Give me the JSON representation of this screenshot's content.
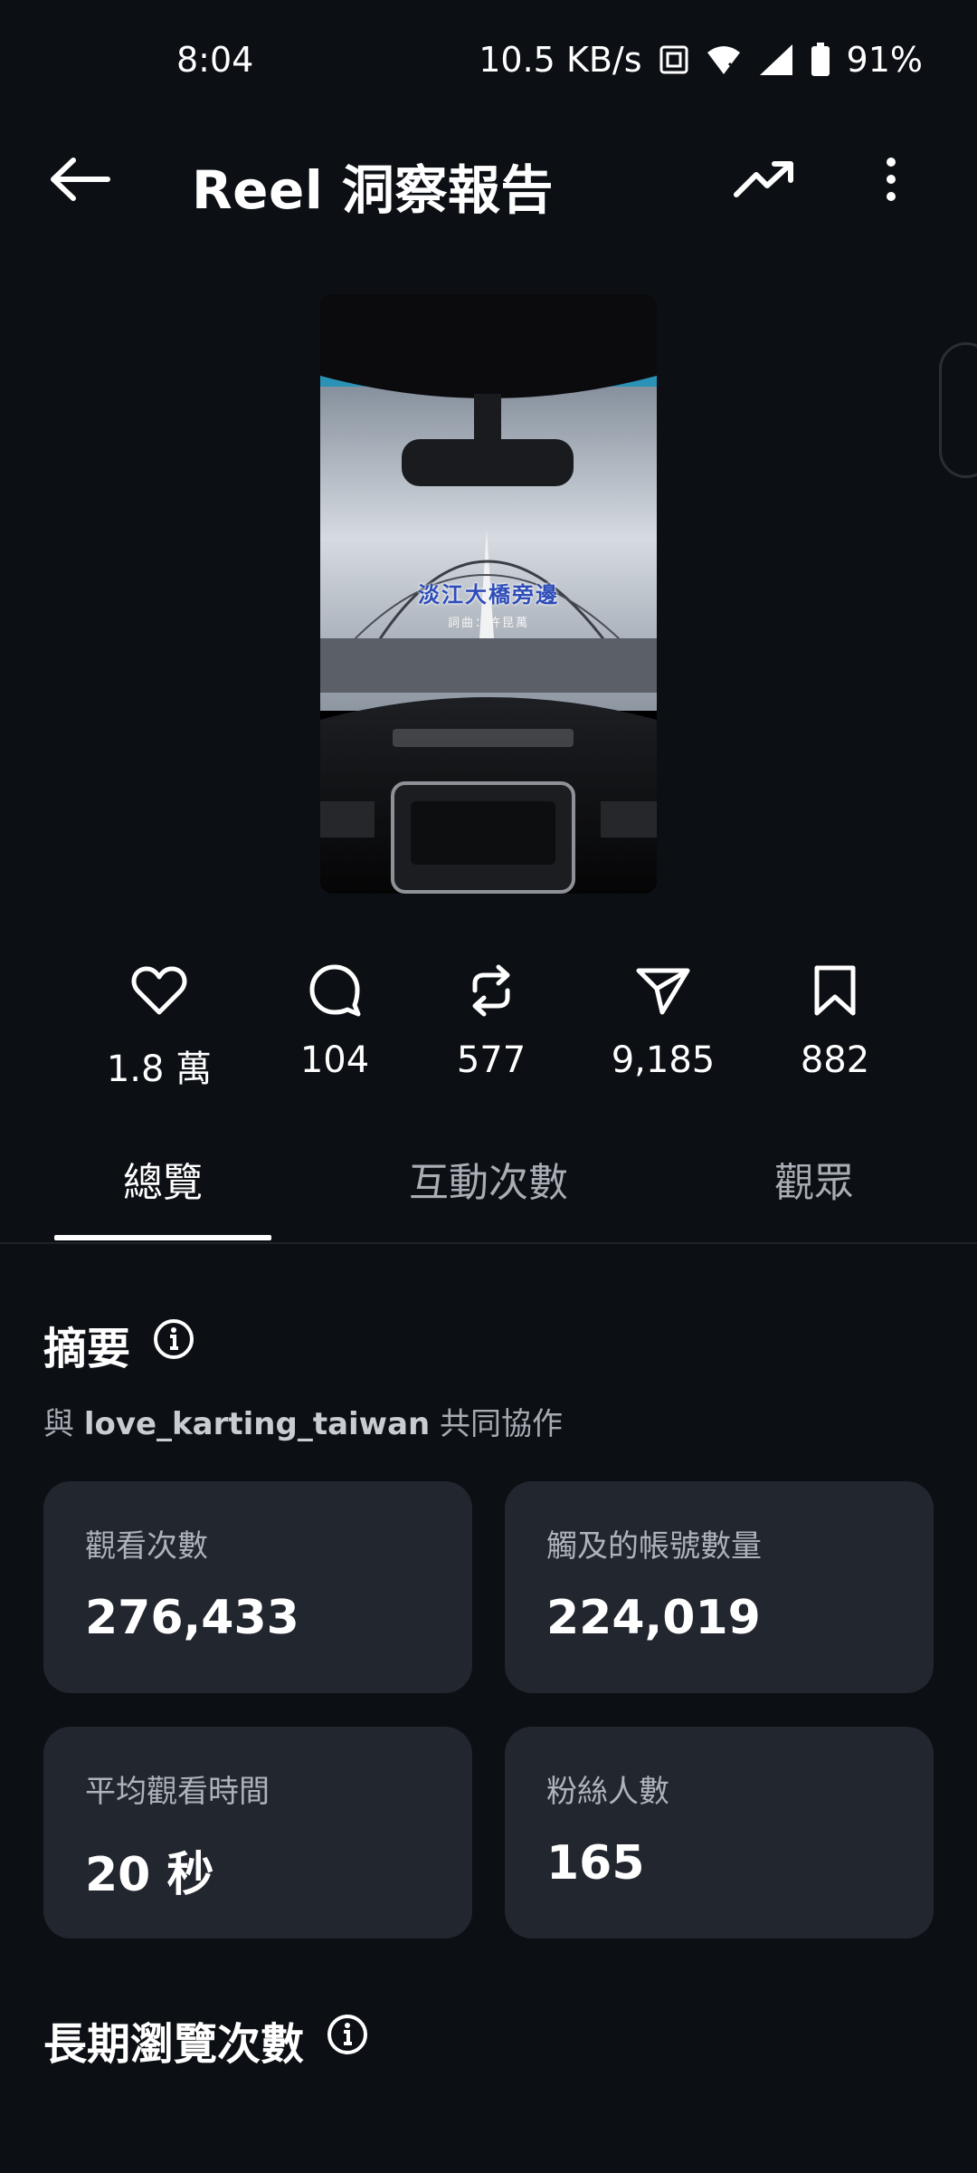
{
  "status_bar": {
    "time": "8:04",
    "network_speed": "10.5 KB/s",
    "battery": "91%",
    "icons": [
      "nfc-icon",
      "wifi-icon",
      "signal-icon",
      "battery-icon"
    ]
  },
  "header": {
    "title": "Reel 洞察報告",
    "icons": [
      "back-arrow-icon",
      "trending-icon",
      "more-vertical-icon"
    ]
  },
  "reel": {
    "caption": "淡江大橋旁邊",
    "sub_caption": "詞曲：許昆萬"
  },
  "stats": [
    {
      "icon": "heart-icon",
      "value": "1.8 萬"
    },
    {
      "icon": "comment-icon",
      "value": "104"
    },
    {
      "icon": "repost-icon",
      "value": "577"
    },
    {
      "icon": "share-icon",
      "value": "9,185"
    },
    {
      "icon": "bookmark-icon",
      "value": "882"
    }
  ],
  "tabs": [
    {
      "label": "總覽",
      "active": true
    },
    {
      "label": "互動次數",
      "active": false
    },
    {
      "label": "觀眾",
      "active": false
    }
  ],
  "summary": {
    "title": "摘要",
    "collab_prefix": "與",
    "collab_account": "love_karting_taiwan",
    "collab_suffix": "共同協作",
    "cards": [
      {
        "label": "觀看次數",
        "value": "276,433"
      },
      {
        "label": "觸及的帳號數量",
        "value": "224,019"
      },
      {
        "label": "平均觀看時間",
        "value": "20 秒"
      },
      {
        "label": "粉絲人數",
        "value": "165"
      }
    ]
  },
  "long_term": {
    "title": "長期瀏覽次數"
  },
  "colors": {
    "background": "#0c0f14",
    "card": "#22262e",
    "text_primary": "#ffffff",
    "text_secondary": "#aeb2ba"
  }
}
